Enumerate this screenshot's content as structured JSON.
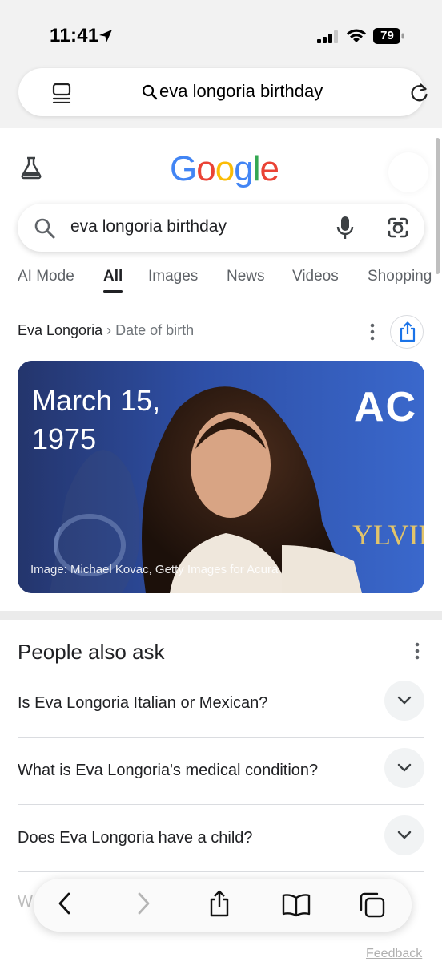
{
  "status": {
    "time": "11:41",
    "battery": "79"
  },
  "safari": {
    "address_text": "eva longoria birthday"
  },
  "google": {
    "logo_letters": [
      {
        "ch": "G",
        "color": "#4285F4"
      },
      {
        "ch": "o",
        "color": "#EA4335"
      },
      {
        "ch": "o",
        "color": "#FBBC05"
      },
      {
        "ch": "g",
        "color": "#4285F4"
      },
      {
        "ch": "l",
        "color": "#34A853"
      },
      {
        "ch": "e",
        "color": "#EA4335"
      }
    ],
    "search_value": "eva longoria birthday",
    "tabs": [
      {
        "label": "AI Mode",
        "active": false
      },
      {
        "label": "All",
        "active": true
      },
      {
        "label": "Images",
        "active": false
      },
      {
        "label": "News",
        "active": false
      },
      {
        "label": "Videos",
        "active": false
      },
      {
        "label": "Shopping",
        "active": false
      }
    ]
  },
  "answer": {
    "entity": "Eva Longoria",
    "separator": "›",
    "attribute": "Date of birth",
    "date": "March 15, 1975",
    "image_credit": "Image: Michael Kovac, Getty Images for Acura",
    "backdrop_text_1": "AC",
    "backdrop_text_2": "YLVIE"
  },
  "people_also_ask": {
    "title": "People also ask",
    "questions": [
      "Is Eva Longoria Italian or Mexican?",
      "What is Eva Longoria's medical condition?",
      "Does Eva Longoria have a child?"
    ],
    "peek_text": "W"
  },
  "footer": {
    "feedback": "Feedback"
  },
  "colors": {
    "accent_blue": "#1a73e8",
    "text_primary": "#202124",
    "text_secondary": "#5f6368"
  },
  "icons": [
    "location-arrow-icon",
    "cellular-signal-icon",
    "wifi-icon",
    "battery-icon",
    "tabs-overview-icon",
    "search-icon",
    "reload-icon",
    "labs-flask-icon",
    "microphone-icon",
    "google-lens-icon",
    "more-vert-icon",
    "share-icon",
    "chevron-down-icon",
    "back-icon",
    "forward-icon",
    "bookmarks-icon",
    "tabs-icon"
  ]
}
